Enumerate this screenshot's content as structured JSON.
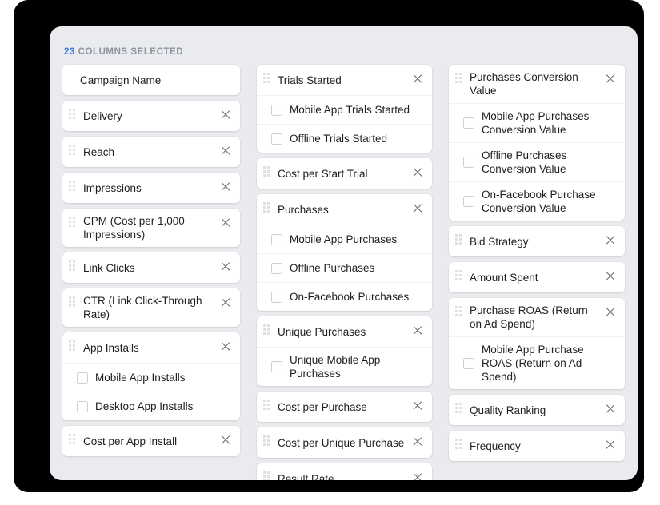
{
  "header": {
    "count": "23",
    "label": "COLUMNS SELECTED",
    "accent_color": "#3578e5",
    "label_color": "#8d949e"
  },
  "icons": {
    "drag_handle": "drag-handle-icon",
    "remove": "close-icon",
    "checkbox": "checkbox-unchecked-icon"
  },
  "columns": [
    {
      "id": "column-1",
      "cards": [
        {
          "label": "Campaign Name",
          "has_handle": false,
          "has_remove": false,
          "children": []
        },
        {
          "label": "Delivery",
          "has_handle": true,
          "has_remove": true,
          "children": []
        },
        {
          "label": "Reach",
          "has_handle": true,
          "has_remove": true,
          "children": []
        },
        {
          "label": "Impressions",
          "has_handle": true,
          "has_remove": true,
          "children": []
        },
        {
          "label": "CPM (Cost per 1,000 Impressions)",
          "has_handle": true,
          "has_remove": true,
          "children": []
        },
        {
          "label": "Link Clicks",
          "has_handle": true,
          "has_remove": true,
          "children": []
        },
        {
          "label": "CTR (Link Click-Through Rate)",
          "has_handle": true,
          "has_remove": true,
          "children": []
        },
        {
          "label": "App Installs",
          "has_handle": true,
          "has_remove": true,
          "children": [
            {
              "label": "Mobile App Installs",
              "checked": false
            },
            {
              "label": "Desktop App Installs",
              "checked": false
            }
          ]
        },
        {
          "label": "Cost per App Install",
          "has_handle": true,
          "has_remove": true,
          "children": []
        }
      ]
    },
    {
      "id": "column-2",
      "cards": [
        {
          "label": "Trials Started",
          "has_handle": true,
          "has_remove": true,
          "children": [
            {
              "label": "Mobile App Trials Started",
              "checked": false
            },
            {
              "label": "Offline Trials Started",
              "checked": false
            }
          ]
        },
        {
          "label": "Cost per Start Trial",
          "has_handle": true,
          "has_remove": true,
          "children": []
        },
        {
          "label": "Purchases",
          "has_handle": true,
          "has_remove": true,
          "children": [
            {
              "label": "Mobile App Purchases",
              "checked": false
            },
            {
              "label": "Offline Purchases",
              "checked": false
            },
            {
              "label": "On-Facebook Purchases",
              "checked": false
            }
          ]
        },
        {
          "label": "Unique Purchases",
          "has_handle": true,
          "has_remove": true,
          "children": [
            {
              "label": "Unique Mobile App Purchases",
              "checked": false
            }
          ]
        },
        {
          "label": "Cost per Purchase",
          "has_handle": true,
          "has_remove": true,
          "children": []
        },
        {
          "label": "Cost per Unique Purchase",
          "has_handle": true,
          "has_remove": true,
          "children": []
        },
        {
          "label": "Result Rate",
          "has_handle": true,
          "has_remove": true,
          "children": []
        }
      ]
    },
    {
      "id": "column-3",
      "cards": [
        {
          "label": "Purchases Conversion Value",
          "has_handle": true,
          "has_remove": true,
          "children": [
            {
              "label": "Mobile App Purchases Conversion Value",
              "checked": false
            },
            {
              "label": "Offline Purchases Conversion Value",
              "checked": false
            },
            {
              "label": "On-Facebook Purchase Conversion Value",
              "checked": false
            }
          ]
        },
        {
          "label": "Bid Strategy",
          "has_handle": true,
          "has_remove": true,
          "children": []
        },
        {
          "label": "Amount Spent",
          "has_handle": true,
          "has_remove": true,
          "children": []
        },
        {
          "label": "Purchase ROAS (Return on Ad Spend)",
          "has_handle": true,
          "has_remove": true,
          "children": [
            {
              "label": "Mobile App Purchase ROAS (Return on Ad Spend)",
              "checked": false
            }
          ]
        },
        {
          "label": "Quality Ranking",
          "has_handle": true,
          "has_remove": true,
          "children": []
        },
        {
          "label": "Frequency",
          "has_handle": true,
          "has_remove": true,
          "children": []
        }
      ]
    }
  ]
}
